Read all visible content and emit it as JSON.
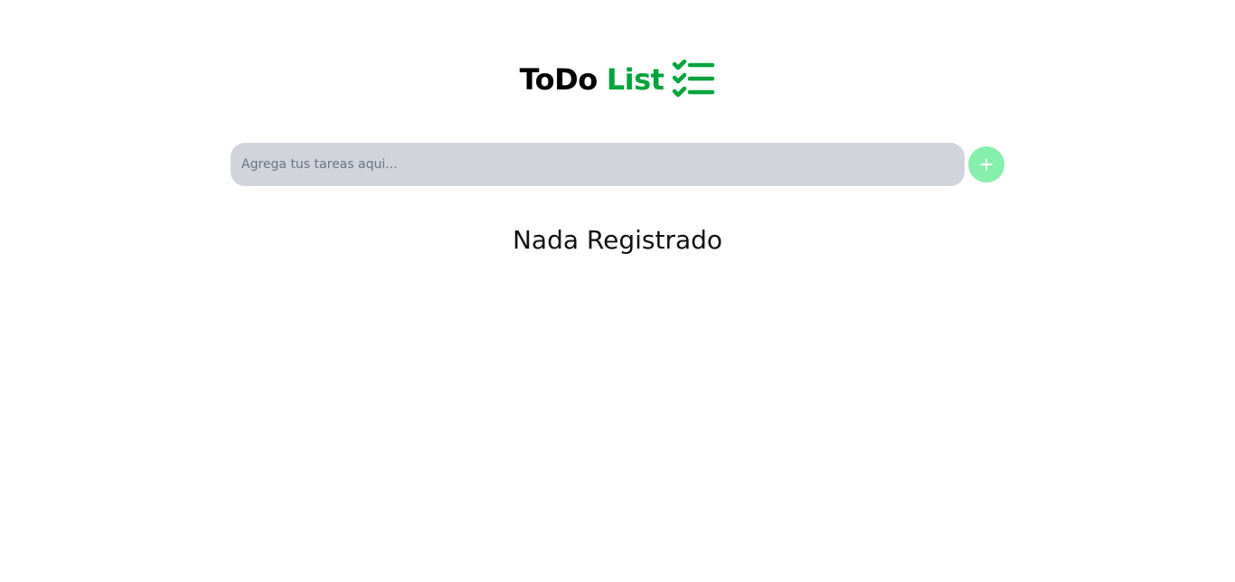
{
  "header": {
    "title_primary": "ToDo",
    "title_accent": "List",
    "icon": "checklist-icon"
  },
  "task_form": {
    "input_placeholder": "Agrega tus tareas aqui...",
    "input_value": "",
    "add_button_icon": "plus-icon"
  },
  "task_list": {
    "empty_message": "Nada Registrado",
    "items": []
  },
  "colors": {
    "background": "#ffffff",
    "title_text": "#000000",
    "accent_green": "#00a33c",
    "input_background": "#d1d5db",
    "add_button_background": "#86efac",
    "add_button_icon": "#ffffff",
    "empty_message_text": "#111111"
  }
}
